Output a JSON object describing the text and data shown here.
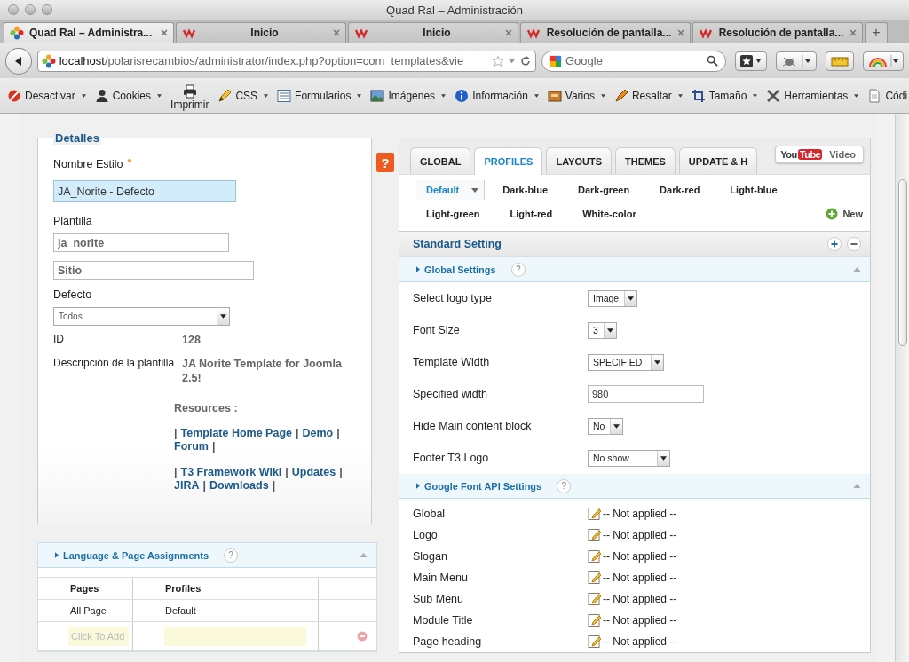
{
  "window": {
    "title": "Quad Ral – Administración"
  },
  "tabs": [
    {
      "label": "Quad Ral – Administra...",
      "selected": true
    },
    {
      "label": "Inicio",
      "selected": false
    },
    {
      "label": "Inicio",
      "selected": false
    },
    {
      "label": "Resolución de pantalla...",
      "selected": false
    },
    {
      "label": "Resolución de pantalla...",
      "selected": false
    }
  ],
  "new_tab": "+",
  "address_bar": {
    "host": "localhost",
    "path": "/polarisrecambios/administrator/index.php?option=com_templates&vie"
  },
  "search": {
    "placeholder": "Google"
  },
  "toolbar": [
    {
      "label": "Desactivar",
      "kind": "menu"
    },
    {
      "label": "Cookies",
      "kind": "menu"
    },
    {
      "label": "Imprimir",
      "kind": "stacked"
    },
    {
      "label": "CSS",
      "kind": "menu"
    },
    {
      "label": "Formularios",
      "kind": "menu"
    },
    {
      "label": "Imágenes",
      "kind": "menu"
    },
    {
      "label": "Información",
      "kind": "menu"
    },
    {
      "label": "Varios",
      "kind": "menu"
    },
    {
      "label": "Resaltar",
      "kind": "menu"
    },
    {
      "label": "Tamaño",
      "kind": "menu"
    },
    {
      "label": "Herramientas",
      "kind": "menu"
    },
    {
      "label": "Códi",
      "kind": "plain"
    }
  ],
  "details": {
    "legend": "Detalles",
    "style_name": {
      "label": "Nombre Estilo",
      "required": true,
      "value": "JA_Norite - Defecto",
      "focused": true
    },
    "template": {
      "label": "Plantilla",
      "value": "ja_norite"
    },
    "client": {
      "value": "Sitio"
    },
    "default": {
      "label": "Defecto",
      "value": "Todos"
    },
    "id": {
      "label": "ID",
      "value": "128"
    },
    "description": {
      "label": "Descripción de la plantilla",
      "title": "JA Norite Template for Joomla 2.5!",
      "resources_label": "Resources :",
      "separator": "|",
      "link_groups": [
        [
          "Template Home Page",
          "Demo",
          "Forum"
        ],
        [
          "T3 Framework Wiki",
          "Updates",
          "JIRA",
          "Downloads"
        ]
      ]
    }
  },
  "assignments": {
    "title": "Language & Page Assignments",
    "help": "?",
    "columns": [
      "Pages",
      "Profiles"
    ],
    "rows": [
      {
        "page": "All Page",
        "profile": "Default"
      }
    ],
    "new_row": {
      "placeholder": "Click To Add"
    }
  },
  "help_button": "?",
  "main_tabs": [
    {
      "label": "GLOBAL",
      "selected": false
    },
    {
      "label": "PROFILES",
      "selected": true
    },
    {
      "label": "LAYOUTS",
      "selected": false
    },
    {
      "label": "THEMES",
      "selected": false
    },
    {
      "label": "UPDATE & H",
      "selected": false
    }
  ],
  "video_badge": {
    "brand_first": "You",
    "brand_second": "Tube",
    "label": "Video"
  },
  "profiles": [
    {
      "label": "Default",
      "selected": true
    },
    {
      "label": "Dark-blue",
      "selected": false
    },
    {
      "label": "Dark-green",
      "selected": false
    },
    {
      "label": "Dark-red",
      "selected": false
    },
    {
      "label": "Light-blue",
      "selected": false
    },
    {
      "label": "Light-green",
      "selected": false
    },
    {
      "label": "Light-red",
      "selected": false
    },
    {
      "label": "White-color",
      "selected": false
    }
  ],
  "new_button": "New",
  "standard_setting": {
    "title": "Standard Setting"
  },
  "groups": [
    {
      "title": "Global Settings",
      "help": "?",
      "rows": [
        {
          "kind": "select",
          "label": "Select logo type",
          "value": "Image"
        },
        {
          "kind": "select",
          "label": "Font Size",
          "value": "3"
        },
        {
          "kind": "select",
          "label": "Template Width",
          "value": "SPECIFIED"
        },
        {
          "kind": "text",
          "label": "Specified width",
          "value": "980"
        },
        {
          "kind": "select",
          "label": "Hide Main content block",
          "value": "No"
        },
        {
          "kind": "select",
          "label": "Footer T3 Logo",
          "value": "No show"
        }
      ]
    },
    {
      "title": "Google Font API Settings",
      "help": "?",
      "rows": [
        {
          "kind": "font",
          "label": "Global",
          "value": "-- Not applied --"
        },
        {
          "kind": "font",
          "label": "Logo",
          "value": "-- Not applied --"
        },
        {
          "kind": "font",
          "label": "Slogan",
          "value": "-- Not applied --"
        },
        {
          "kind": "font",
          "label": "Main Menu",
          "value": "-- Not applied --"
        },
        {
          "kind": "font",
          "label": "Sub Menu",
          "value": "-- Not applied --"
        },
        {
          "kind": "font",
          "label": "Module Title",
          "value": "-- Not applied --"
        },
        {
          "kind": "font",
          "label": "Page heading",
          "value": "-- Not applied --"
        }
      ]
    }
  ]
}
